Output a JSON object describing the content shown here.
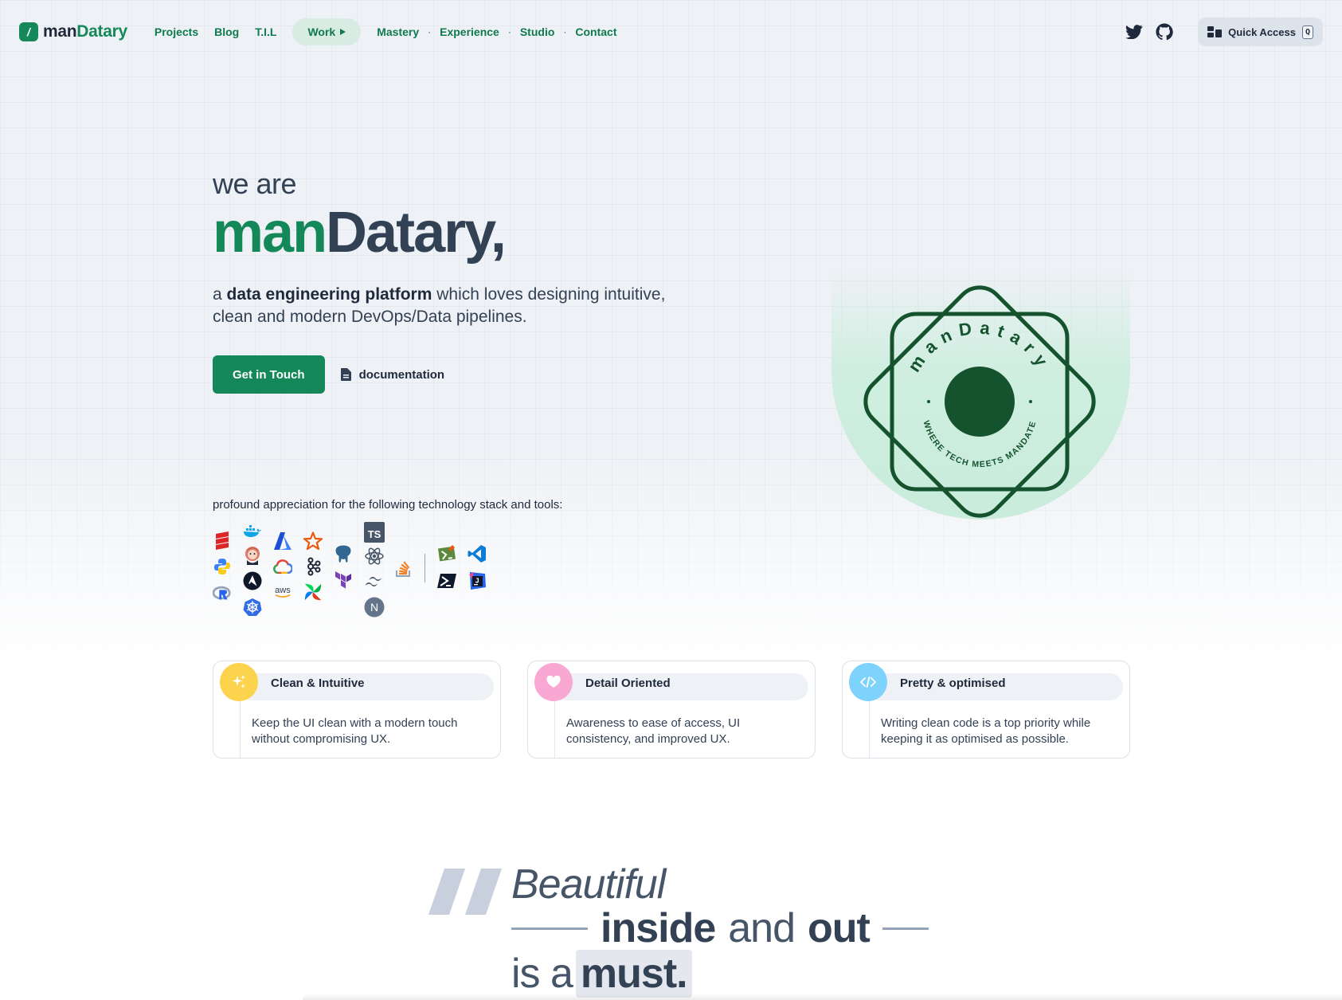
{
  "nav": {
    "logo_mark": "/",
    "logo_prefix": "man",
    "logo_suffix": "Datary",
    "links": [
      "Projects",
      "Blog",
      "T.I.L",
      "Work",
      "Mastery",
      "Experience",
      "Studio",
      "Contact"
    ],
    "quick_access_label": "Quick Access",
    "quick_access_key": "Q"
  },
  "hero": {
    "we_are": "we are",
    "brand_prefix": "man",
    "brand_suffix": "Datary,",
    "tagline_prefix": "a",
    "tagline_bold": "data engineering platform",
    "tagline_rest": "which loves designing intuitive, clean and modern DevOps/Data pipelines.",
    "cta_primary": "Get in Touch",
    "cta_secondary": "documentation"
  },
  "emblem": {
    "ring_text_top": "manDatary",
    "ring_text_bottom": "WHERE TECH MEETS MANDATE"
  },
  "stack": {
    "label": "profound appreciation for the following technology stack and tools:",
    "icons": [
      "scala-icon",
      "docker-icon",
      "azure-icon",
      "star-icon",
      "typescript-icon",
      "python-icon",
      "jenkins-icon",
      "gcp-icon",
      "kafka-icon",
      "postgres-icon",
      "react-icon",
      "stackoverflow-icon",
      "git-icon",
      "vscode-icon",
      "r-icon",
      "ansible-icon",
      "aws-icon",
      "airflow-icon",
      "terraform-icon",
      "tailwind-icon",
      "powershell-icon",
      "jetbrains-icon",
      "kubernetes-icon",
      "nextjs-icon"
    ],
    "aws_text": "aws",
    "ts_text": "TS",
    "next_text": "N"
  },
  "cards": [
    {
      "title": "Clean & Intuitive",
      "body": "Keep the UI clean with a modern touch without compromising UX.",
      "icon": "sparkle-icon",
      "color": "#fcd34d"
    },
    {
      "title": "Detail Oriented",
      "body": "Awareness to ease of access, UI consistency, and improved UX.",
      "icon": "heart-icon",
      "color": "#f9a8d4"
    },
    {
      "title": "Pretty & optimised",
      "body": "Writing clean code is a top priority while keeping it as optimised as possible.",
      "icon": "code-icon",
      "color": "#7dd3fc"
    }
  ],
  "quote": {
    "line1": "Beautiful",
    "inside": "inside",
    "and": "and",
    "out": "out",
    "is_a": "is a",
    "must": "must."
  },
  "colors": {
    "brand": "#15885a",
    "brand_dark": "#14532d",
    "text": "#334155"
  }
}
